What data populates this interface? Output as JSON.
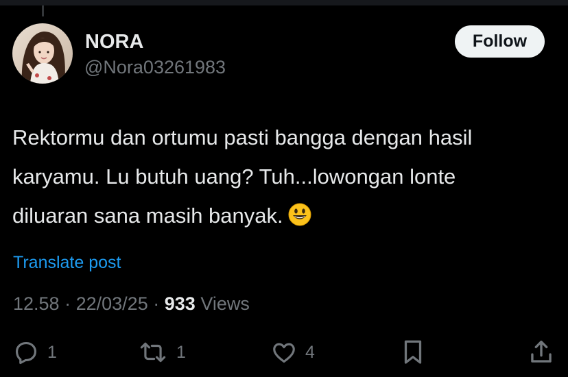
{
  "author": {
    "display_name": "NORA",
    "handle": "@Nora03261983"
  },
  "follow_label": "Follow",
  "tweet": {
    "lines": [
      "Rektormu dan ortumu pasti bangga dengan hasil",
      "karyamu. Lu butuh uang? Tuh...lowongan lonte",
      "diluaran sana masih banyak."
    ],
    "emoji": "smiling-face-emoji"
  },
  "translate_label": "Translate post",
  "meta": {
    "time": "12.58",
    "sep1": "·",
    "date": "22/03/25",
    "sep2": "·",
    "views_count": "933",
    "views_label": "Views"
  },
  "actions": {
    "replies": "1",
    "reposts": "1",
    "likes": "4"
  },
  "colors": {
    "background": "#000000",
    "text": "#e7e9ea",
    "secondary": "#71767b",
    "link": "#1d9bf0",
    "button_bg": "#eff3f4"
  }
}
